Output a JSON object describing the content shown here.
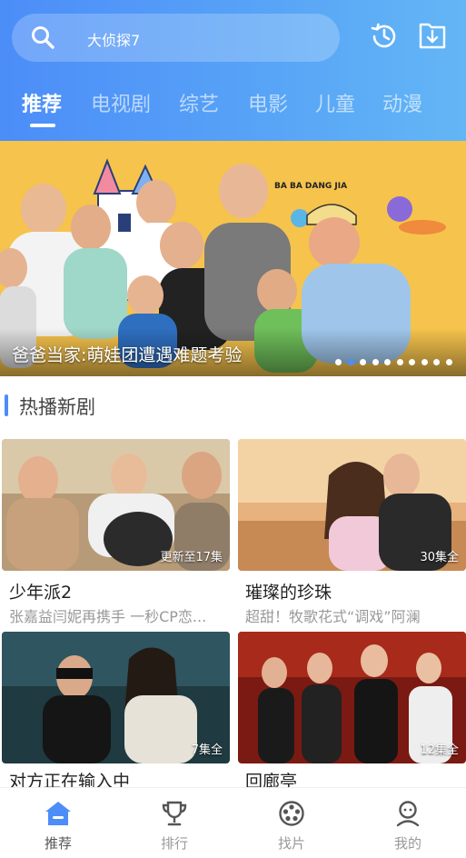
{
  "search": {
    "text": "大侦探7",
    "icon": "search-icon"
  },
  "header_actions": {
    "history_icon": "history-icon",
    "download_icon": "download-icon"
  },
  "tabs": [
    {
      "label": "推荐",
      "active": true
    },
    {
      "label": "电视剧",
      "active": false
    },
    {
      "label": "综艺",
      "active": false
    },
    {
      "label": "电影",
      "active": false
    },
    {
      "label": "儿童",
      "active": false
    },
    {
      "label": "动漫",
      "active": false
    }
  ],
  "banner": {
    "caption": "爸爸当家:萌娃团遭遇难题考验",
    "dots_total": 10,
    "dots_active_index": 1,
    "poster_text": "BA BA DANG JIA"
  },
  "section": {
    "title": "热播新剧"
  },
  "cards": [
    {
      "title": "少年派2",
      "subtitle": "张嘉益闫妮再携手 一秒CP恋...",
      "badge": "更新至17集"
    },
    {
      "title": "璀璨的珍珠",
      "subtitle": "超甜！牧歌花式“调戏”阿澜",
      "badge": "30集全"
    },
    {
      "title": "对方正在输入中",
      "subtitle": "",
      "badge": "7集全"
    },
    {
      "title": "回廊亭",
      "subtitle": "",
      "badge": "12集全"
    }
  ],
  "bottom_nav": [
    {
      "label": "推荐",
      "icon": "home-icon",
      "active": true
    },
    {
      "label": "排行",
      "icon": "trophy-icon",
      "active": false
    },
    {
      "label": "找片",
      "icon": "film-reel-icon",
      "active": false
    },
    {
      "label": "我的",
      "icon": "user-icon",
      "active": false
    }
  ],
  "colors": {
    "accent": "#4c8df8",
    "header_end": "#63b6f5",
    "banner_bg": "#f6c34c"
  }
}
